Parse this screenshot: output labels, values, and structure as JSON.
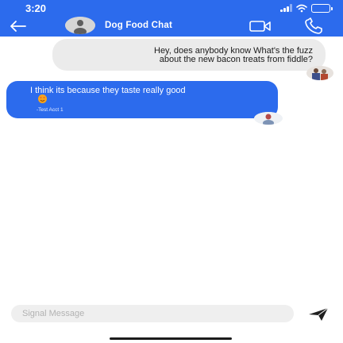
{
  "status_bar": {
    "time": "3:20"
  },
  "header": {
    "title": "Dog Food Chat",
    "accent_color": "#2c6bed",
    "icons": [
      "back-arrow-icon",
      "group-avatar",
      "video-call-icon",
      "phone-call-icon"
    ]
  },
  "messages": [
    {
      "direction": "outgoing",
      "lines": [
        "Hey, does anybody know What's the fuzz",
        "about the new bacon treats from fiddle?"
      ]
    },
    {
      "direction": "incoming",
      "text": "I think its because they taste really good",
      "emoji": "😍",
      "sender": "-Test Acct 1"
    }
  ],
  "composer": {
    "placeholder": "Signal Message",
    "value": ""
  }
}
